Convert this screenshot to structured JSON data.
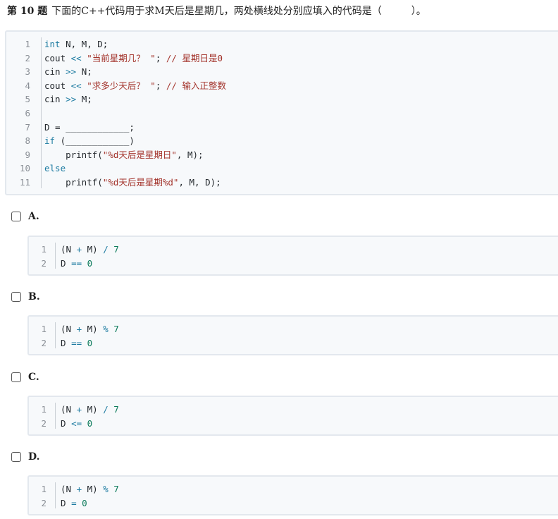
{
  "question": {
    "number_label": "第 10 题",
    "text": "下面的C++代码用于求M天后是星期几，两处横线处分别应填入的代码是（　　　）。"
  },
  "main_code": {
    "lines": [
      {
        "n": "1",
        "parts": [
          {
            "t": "int",
            "c": "kw"
          },
          {
            "t": " N, M, D;",
            "c": ""
          }
        ]
      },
      {
        "n": "2",
        "parts": [
          {
            "t": "cout ",
            "c": ""
          },
          {
            "t": "<<",
            "c": "op"
          },
          {
            "t": " ",
            "c": ""
          },
          {
            "t": "\"当前星期几？ \"",
            "c": "str"
          },
          {
            "t": "; ",
            "c": ""
          },
          {
            "t": "// 星期日是0",
            "c": "cmt"
          }
        ]
      },
      {
        "n": "3",
        "parts": [
          {
            "t": "cin ",
            "c": ""
          },
          {
            "t": ">>",
            "c": "op"
          },
          {
            "t": " N;",
            "c": ""
          }
        ]
      },
      {
        "n": "4",
        "parts": [
          {
            "t": "cout ",
            "c": ""
          },
          {
            "t": "<<",
            "c": "op"
          },
          {
            "t": " ",
            "c": ""
          },
          {
            "t": "\"求多少天后？ \"",
            "c": "str"
          },
          {
            "t": "; ",
            "c": ""
          },
          {
            "t": "// 输入正整数",
            "c": "cmt"
          }
        ]
      },
      {
        "n": "5",
        "parts": [
          {
            "t": "cin ",
            "c": ""
          },
          {
            "t": ">>",
            "c": "op"
          },
          {
            "t": " M;",
            "c": ""
          }
        ]
      },
      {
        "n": "6",
        "parts": []
      },
      {
        "n": "7",
        "parts": [
          {
            "t": "D = ____________;",
            "c": ""
          }
        ]
      },
      {
        "n": "8",
        "parts": [
          {
            "t": "if",
            "c": "kw"
          },
          {
            "t": " (____________)",
            "c": ""
          }
        ]
      },
      {
        "n": "9",
        "parts": [
          {
            "t": "    printf(",
            "c": ""
          },
          {
            "t": "\"%d天后是星期日\"",
            "c": "str"
          },
          {
            "t": ", M);",
            "c": ""
          }
        ]
      },
      {
        "n": "10",
        "parts": [
          {
            "t": "else",
            "c": "kw"
          }
        ]
      },
      {
        "n": "11",
        "parts": [
          {
            "t": "    printf(",
            "c": ""
          },
          {
            "t": "\"%d天后是星期%d\"",
            "c": "str"
          },
          {
            "t": ", M, D);",
            "c": ""
          }
        ]
      }
    ]
  },
  "options": [
    {
      "label": "A.",
      "lines": [
        {
          "n": "1",
          "parts": [
            {
              "t": "(N ",
              "c": ""
            },
            {
              "t": "+",
              "c": "op"
            },
            {
              "t": " M) ",
              "c": ""
            },
            {
              "t": "/",
              "c": "divop"
            },
            {
              "t": " ",
              "c": ""
            },
            {
              "t": "7",
              "c": "num"
            }
          ]
        },
        {
          "n": "2",
          "parts": [
            {
              "t": "D ",
              "c": ""
            },
            {
              "t": "==",
              "c": "op"
            },
            {
              "t": " ",
              "c": ""
            },
            {
              "t": "0",
              "c": "num"
            }
          ]
        }
      ]
    },
    {
      "label": "B.",
      "lines": [
        {
          "n": "1",
          "parts": [
            {
              "t": "(N ",
              "c": ""
            },
            {
              "t": "+",
              "c": "op"
            },
            {
              "t": " M) ",
              "c": ""
            },
            {
              "t": "%",
              "c": "divop"
            },
            {
              "t": " ",
              "c": ""
            },
            {
              "t": "7",
              "c": "num"
            }
          ]
        },
        {
          "n": "2",
          "parts": [
            {
              "t": "D ",
              "c": ""
            },
            {
              "t": "==",
              "c": "op"
            },
            {
              "t": " ",
              "c": ""
            },
            {
              "t": "0",
              "c": "num"
            }
          ]
        }
      ]
    },
    {
      "label": "C.",
      "lines": [
        {
          "n": "1",
          "parts": [
            {
              "t": "(N ",
              "c": ""
            },
            {
              "t": "+",
              "c": "op"
            },
            {
              "t": " M) ",
              "c": ""
            },
            {
              "t": "/",
              "c": "divop"
            },
            {
              "t": " ",
              "c": ""
            },
            {
              "t": "7",
              "c": "num"
            }
          ]
        },
        {
          "n": "2",
          "parts": [
            {
              "t": "D ",
              "c": ""
            },
            {
              "t": "<=",
              "c": "op"
            },
            {
              "t": " ",
              "c": ""
            },
            {
              "t": "0",
              "c": "num"
            }
          ]
        }
      ]
    },
    {
      "label": "D.",
      "lines": [
        {
          "n": "1",
          "parts": [
            {
              "t": "(N ",
              "c": ""
            },
            {
              "t": "+",
              "c": "op"
            },
            {
              "t": " M) ",
              "c": ""
            },
            {
              "t": "%",
              "c": "divop"
            },
            {
              "t": " ",
              "c": ""
            },
            {
              "t": "7",
              "c": "num"
            }
          ]
        },
        {
          "n": "2",
          "parts": [
            {
              "t": "D ",
              "c": ""
            },
            {
              "t": "=",
              "c": "op"
            },
            {
              "t": " ",
              "c": ""
            },
            {
              "t": "0",
              "c": "num"
            }
          ]
        }
      ]
    }
  ]
}
